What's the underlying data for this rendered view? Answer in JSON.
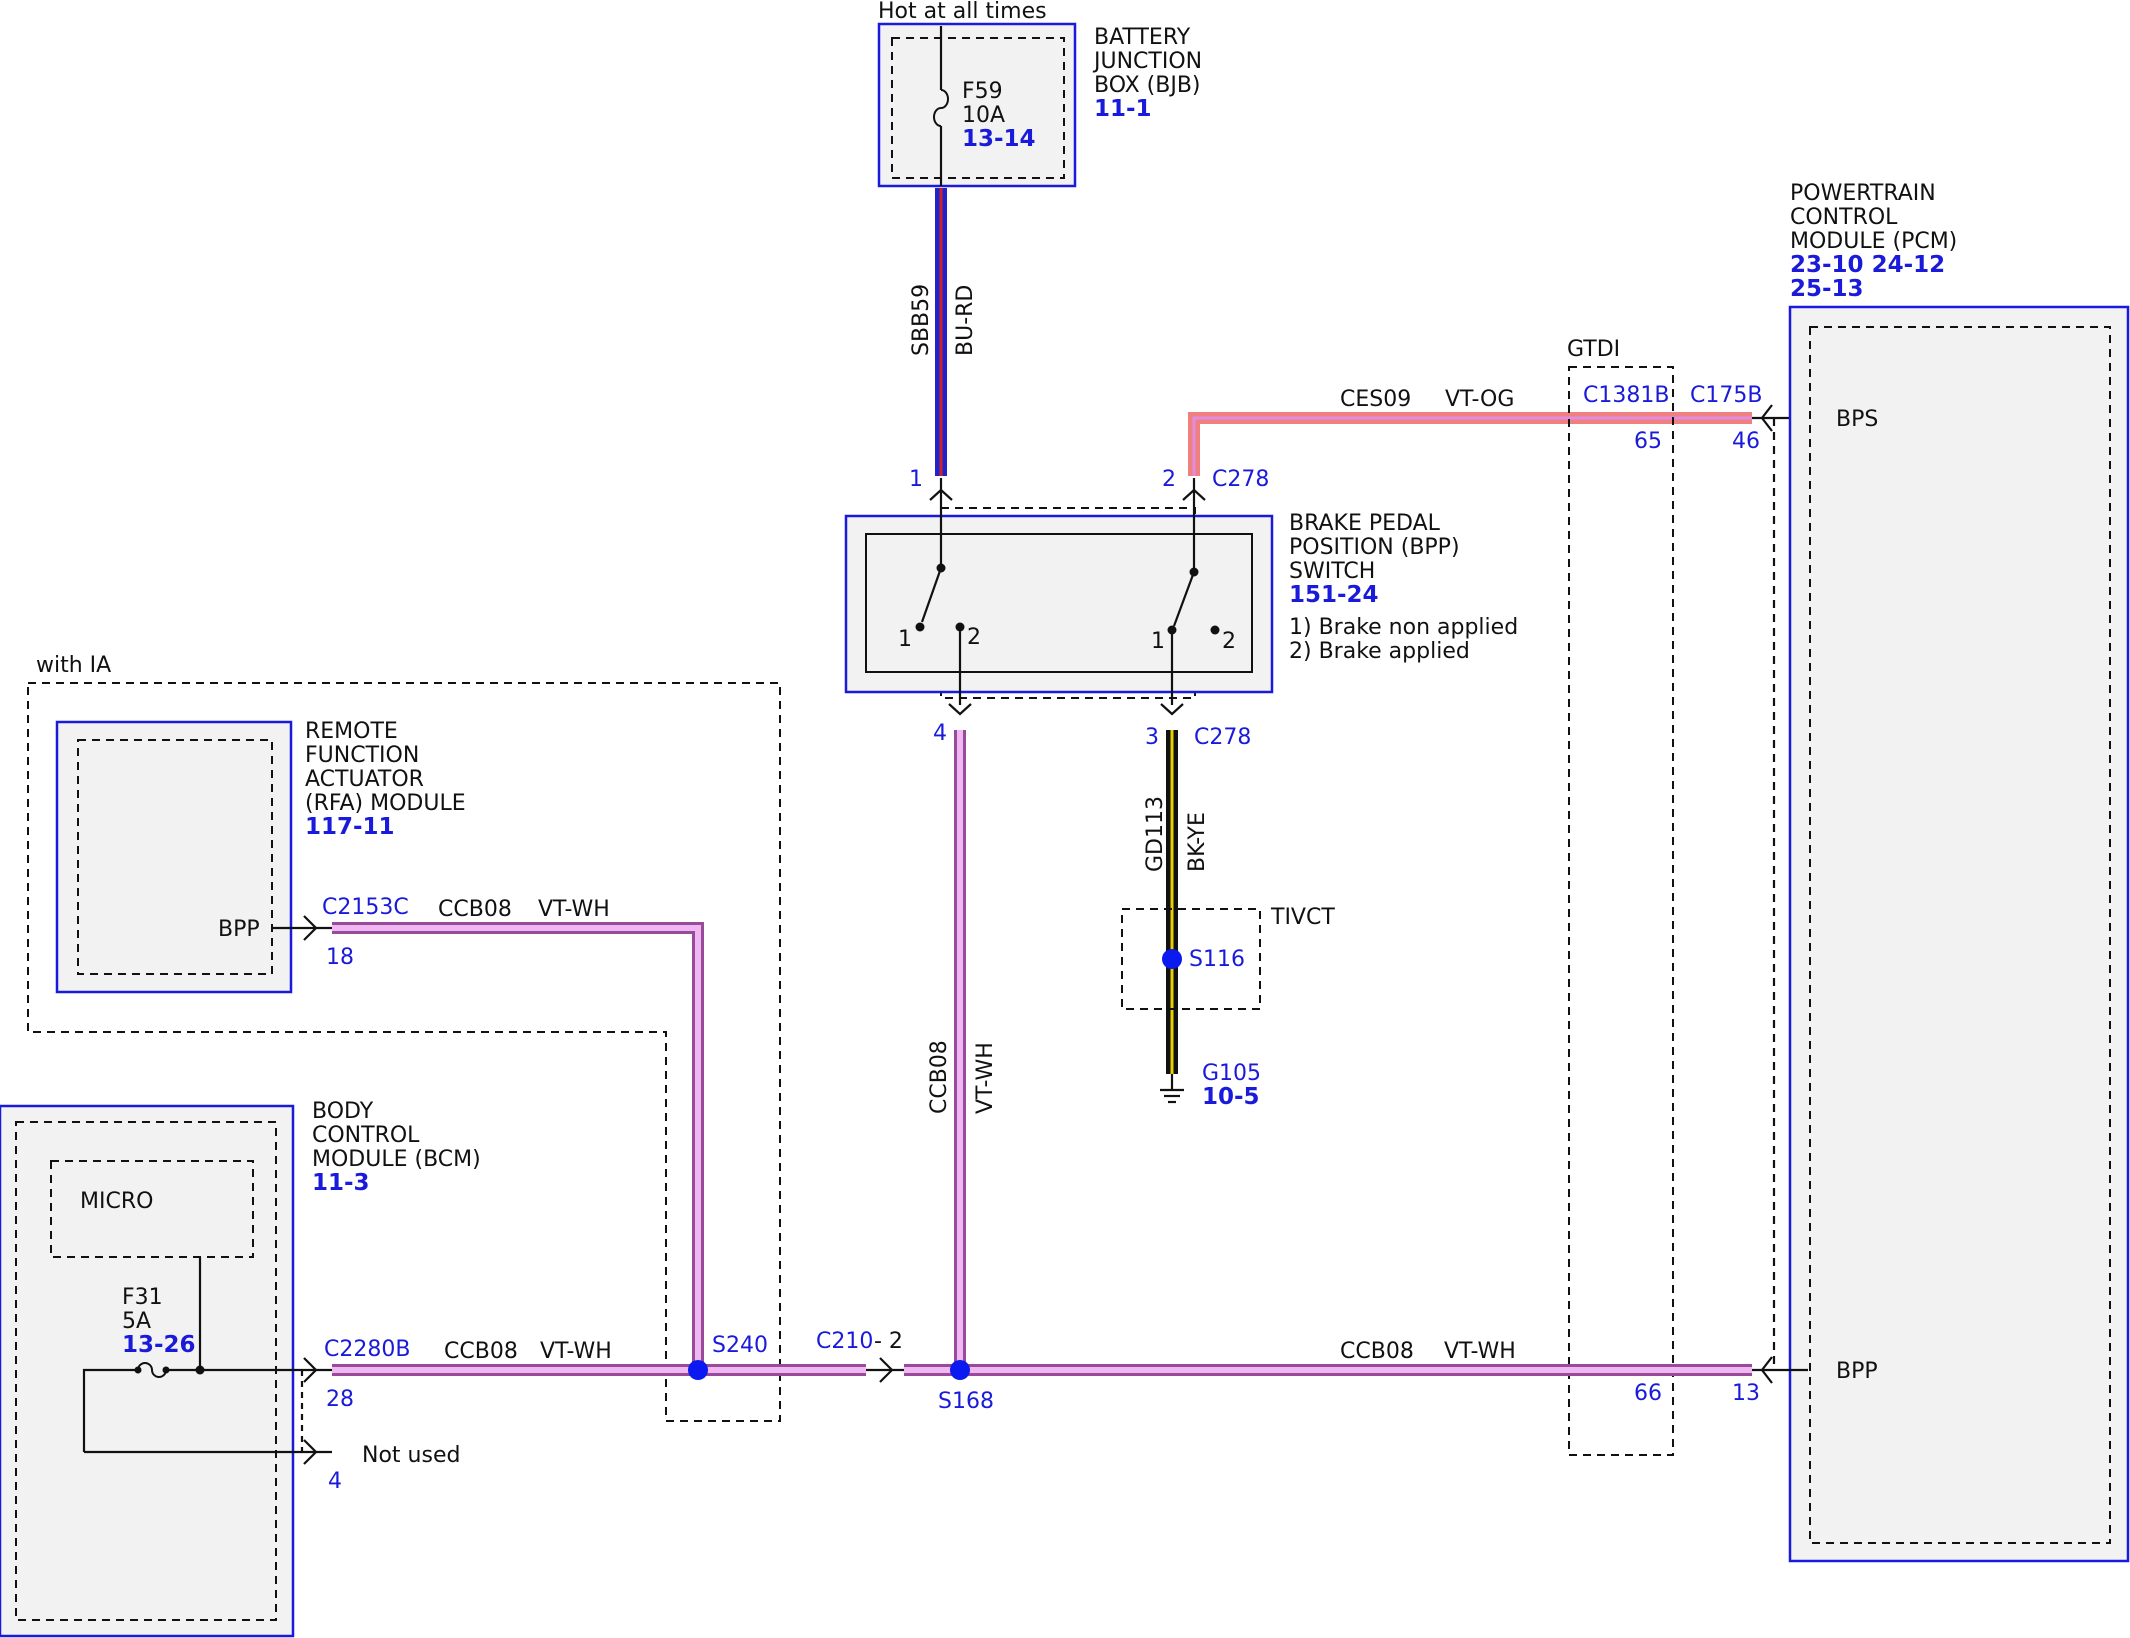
{
  "battery_junction_box": {
    "hot_label": "Hot at all times",
    "title_lines": [
      "BATTERY",
      "JUNCTION",
      "BOX (BJB)"
    ],
    "ref": "11-1",
    "fuse_name": "F59",
    "fuse_rating": "10A",
    "fuse_ref": "13-14"
  },
  "wire_sbb59": {
    "circuit": "SBB59",
    "color": "BU-RD"
  },
  "bpp_switch": {
    "title_lines": [
      "BRAKE PEDAL",
      "POSITION (BPP)",
      "SWITCH"
    ],
    "ref": "151-24",
    "notes": [
      "1) Brake non applied",
      "2) Brake applied"
    ],
    "pin1": "1",
    "pin2": "2",
    "pin3": "3",
    "pin4": "4",
    "connector": "C278",
    "contact_1": "1",
    "contact_2": "2"
  },
  "wire_ces09": {
    "circuit": "CES09",
    "color": "VT-OG"
  },
  "wire_gd113": {
    "circuit": "GD113",
    "color": "BK-YE"
  },
  "wire_ccb08": {
    "circuit": "CCB08",
    "color": "VT-WH"
  },
  "gtdi": {
    "label": "GTDI",
    "connector_top": "C1381B",
    "pin_top": "65",
    "pin_bottom": "66"
  },
  "pcm": {
    "title_lines": [
      "POWERTRAIN",
      "CONTROL",
      "MODULE (PCM)"
    ],
    "refs_line1": "23-10 24-12",
    "refs_line2": "25-13",
    "connector": "C175B",
    "pin_bps": "46",
    "sig_bps": "BPS",
    "pin_bpp": "13",
    "sig_bpp": "BPP"
  },
  "tivct": {
    "label": "TIVCT",
    "splice": "S116"
  },
  "ground": {
    "name": "G105",
    "ref": "10-5"
  },
  "with_ia": {
    "label": "with IA"
  },
  "rfa_module": {
    "title_lines": [
      "REMOTE",
      "FUNCTION",
      "ACTUATOR",
      "(RFA) MODULE"
    ],
    "ref": "117-11",
    "signal": "BPP",
    "connector": "C2153C",
    "pin": "18"
  },
  "bcm": {
    "title_lines": [
      "BODY",
      "CONTROL",
      "MODULE (BCM)"
    ],
    "ref": "11-3",
    "micro": "MICRO",
    "fuse_name": "F31",
    "fuse_rating": "5A",
    "fuse_ref": "13-26",
    "connector": "C2280B",
    "pin": "28",
    "pin_unused": "4",
    "not_used": "Not used"
  },
  "splices": {
    "s240": "S240",
    "s168": "S168"
  },
  "inline_connector": {
    "name": "C210",
    "pin": "- 2"
  },
  "colors": {
    "module_border": "#1a1add",
    "pin_text": "#1a1adb",
    "wire_blue": "#2222cc",
    "wire_red": "#cc2222",
    "wire_violet": "#e08de0",
    "wire_orange_pink": "#f08080",
    "wire_black": "#111111",
    "wire_yellow": "#e8d000",
    "splice_dot": "#0a1af0"
  }
}
